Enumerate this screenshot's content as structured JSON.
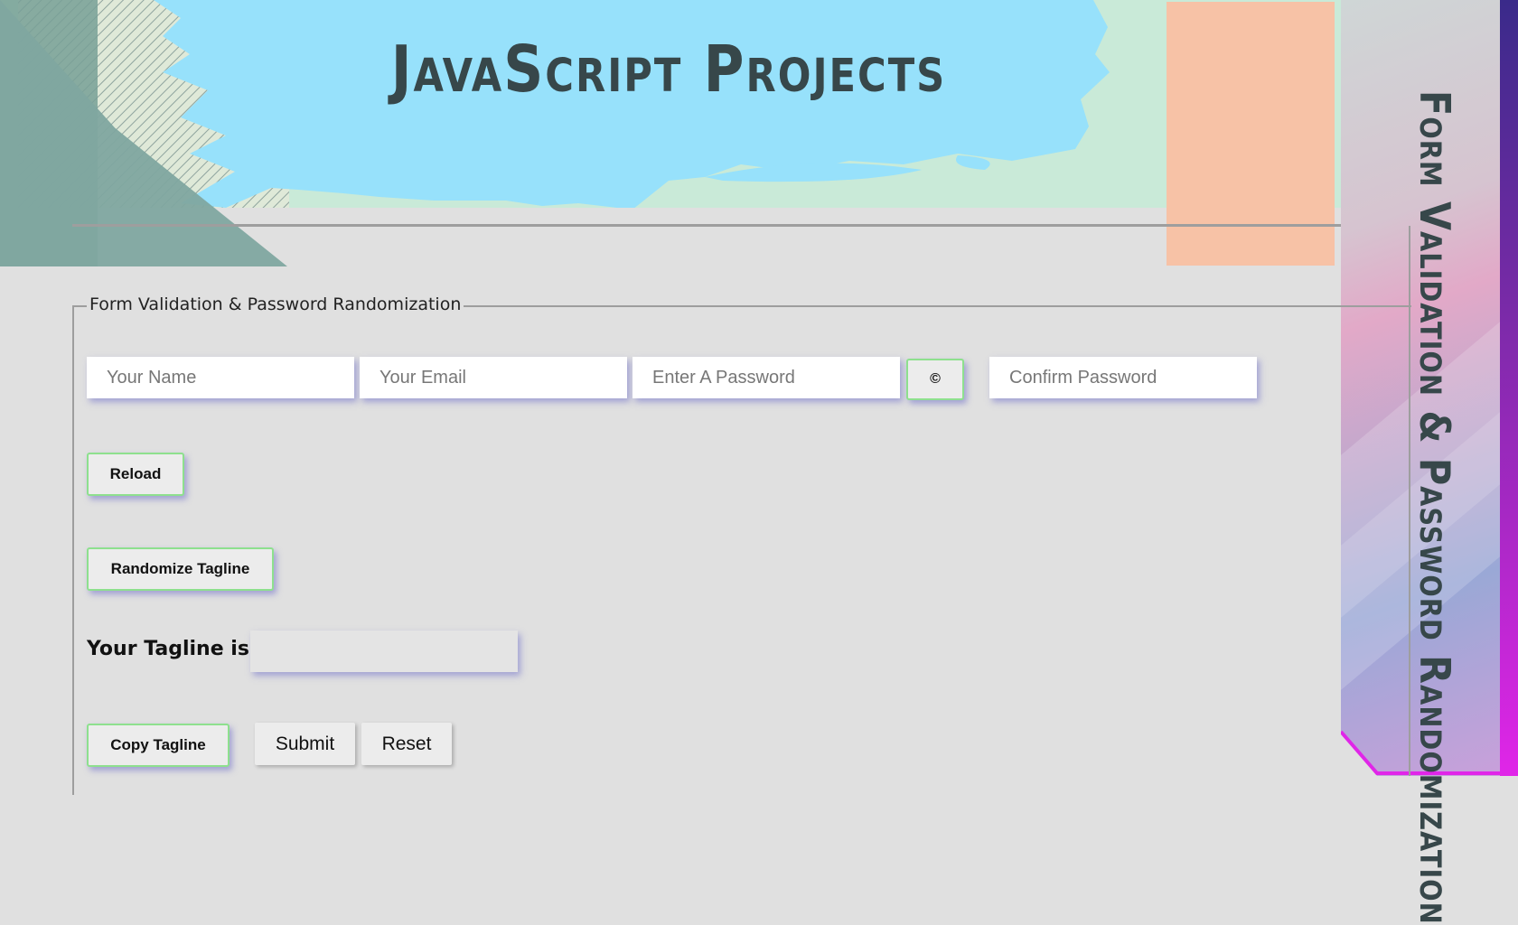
{
  "header": {
    "title": "JavaScript Projects"
  },
  "side_panel": {
    "title": "Form Validation & Password Randomization"
  },
  "form": {
    "legend": "Form Validation & Password Randomization",
    "name_placeholder": "Your Name",
    "email_placeholder": "Your Email",
    "password_placeholder": "Enter A Password",
    "generate_label": "©",
    "confirm_placeholder": "Confirm Password",
    "reload_label": "Reload",
    "randomize_label": "Randomize Tagline",
    "tagline_label": "Your Tagline is :",
    "tagline_value": "",
    "copy_label": "Copy Tagline",
    "submit_label": "Submit",
    "reset_label": "Reset"
  },
  "colors": {
    "background": "#e0e0e0",
    "banner_blue": "#97e1fb",
    "banner_mint": "#c9ead8",
    "peach": "#f7c2a6",
    "button_border": "#8ee08e",
    "title_text": "#37474a",
    "accent_magenta": "#e026e8"
  }
}
